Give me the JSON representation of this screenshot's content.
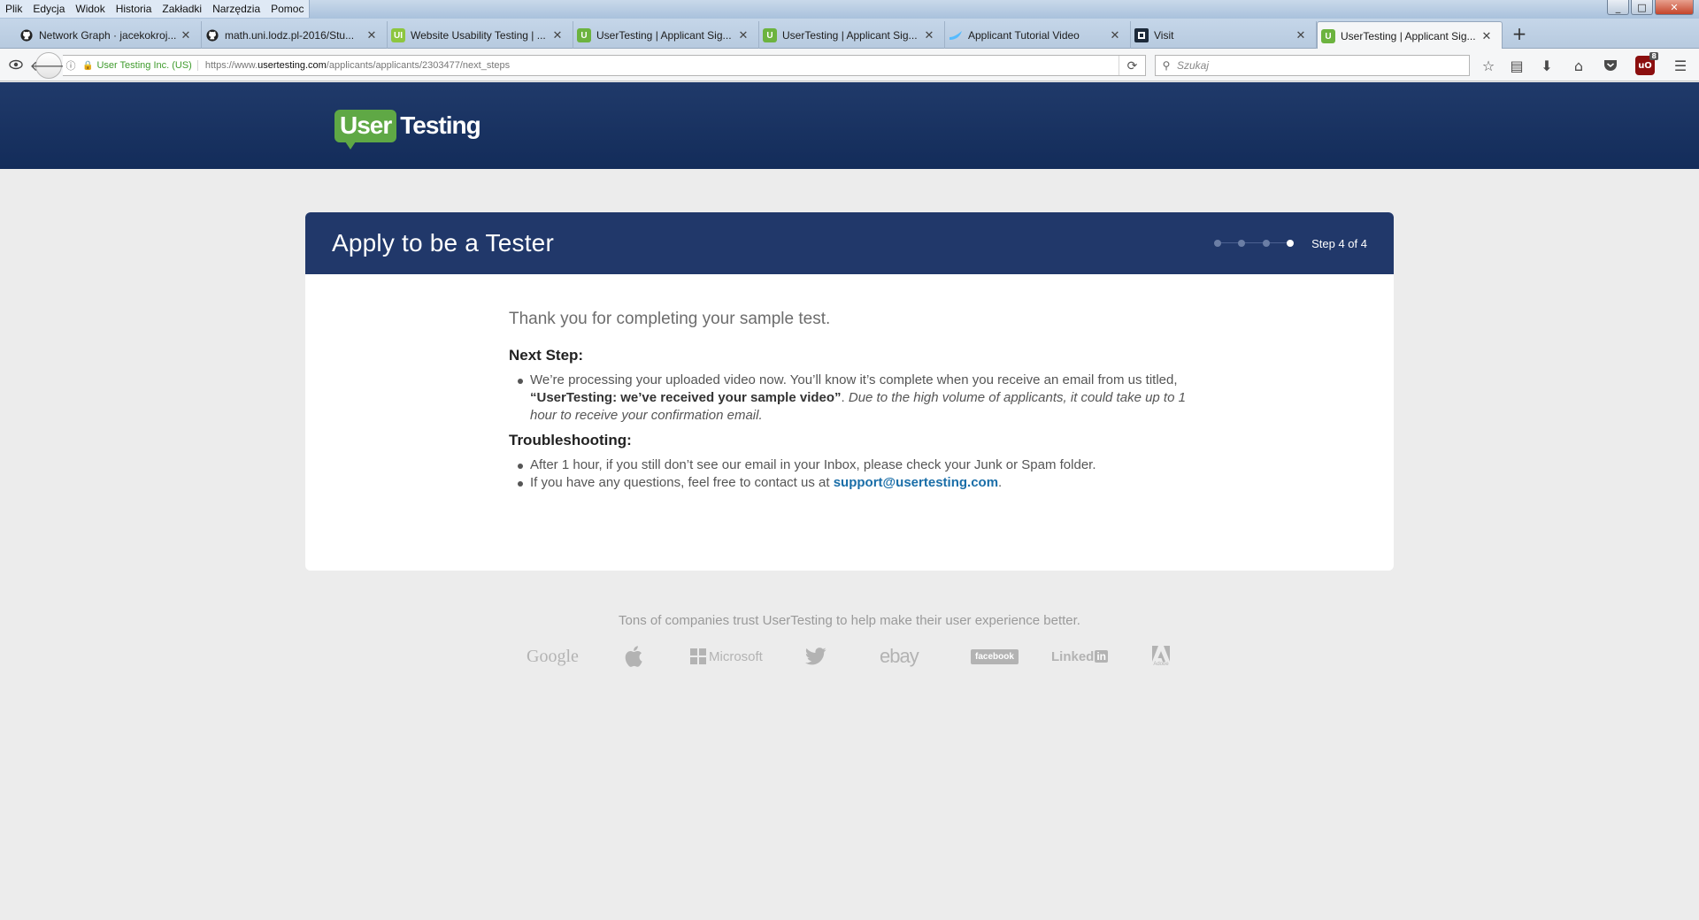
{
  "menubar": {
    "items": [
      "Plik",
      "Edycja",
      "Widok",
      "Historia",
      "Zakładki",
      "Narzędzia",
      "Pomoc"
    ]
  },
  "window_controls": {
    "minimize": "_",
    "maximize": "□",
    "close": "✕"
  },
  "tabs": [
    {
      "title": "Network Graph · jacekokroj...",
      "icon": "github-icon",
      "icon_color": "#222222"
    },
    {
      "title": "math.uni.lodz.pl-2016/Stu...",
      "icon": "github-icon",
      "icon_color": "#222222"
    },
    {
      "title": "Website Usability Testing | ...",
      "icon": "usertesting-icon",
      "icon_color": "#8dc63f",
      "icon_text": "UI"
    },
    {
      "title": "UserTesting | Applicant Sig...",
      "icon": "usertesting-icon",
      "icon_color": "#6cb33f",
      "icon_text": "U"
    },
    {
      "title": "UserTesting | Applicant Sig...",
      "icon": "usertesting-icon",
      "icon_color": "#6cb33f",
      "icon_text": "U"
    },
    {
      "title": "Applicant Tutorial Video",
      "icon": "wistia-icon",
      "icon_color": "#54bbff",
      "icon_text": ""
    },
    {
      "title": "Visit",
      "icon": "visit-icon",
      "icon_color": "#1d2a3a",
      "icon_text": "■"
    },
    {
      "title": "UserTesting | Applicant Sig...",
      "icon": "usertesting-icon",
      "icon_color": "#6cb33f",
      "icon_text": "U",
      "active": true
    }
  ],
  "newtab_label": "+",
  "navbar": {
    "identity": "User Testing Inc. (US)",
    "url_prefix": "https://www.",
    "url_domain": "usertesting.com",
    "url_path": "/applicants/applicants/2303477/next_steps",
    "search_placeholder": "Szukaj"
  },
  "brand": {
    "logo_user": "User",
    "logo_testing": "Testing",
    "primary": "#21386a",
    "green": "#5fa845",
    "link": "#1a6ea8"
  },
  "card": {
    "title": "Apply to be a Tester",
    "step_label": "Step 4 of 4",
    "progress": {
      "current": 4,
      "total": 4
    },
    "thanks": "Thank you for completing your sample test.",
    "next_step_heading": "Next Step:",
    "next_step": {
      "text1": "We’re processing your uploaded video now. You’ll know it’s complete when you receive an email from us titled, ",
      "bold": "“UserTesting: we’ve received your sample video”",
      "text2": ". ",
      "italic": "Due to the high volume of applicants, it could take up to 1 hour to receive your confirmation email."
    },
    "troubleshooting_heading": "Troubleshooting:",
    "trouble_1": "After 1 hour, if you still don’t see our email in your Inbox, please check your Junk or Spam folder.",
    "trouble_2_text": "If you have any questions, feel free to contact us at ",
    "trouble_2_link": "support@usertesting.com",
    "trouble_2_end": "."
  },
  "footer": {
    "trust_text": "Tons of companies trust UserTesting to help make their user experience better.",
    "logos": [
      "Google",
      "",
      "Microsoft",
      "",
      "ebay",
      "facebook",
      "Linked",
      "Adobe"
    ]
  }
}
